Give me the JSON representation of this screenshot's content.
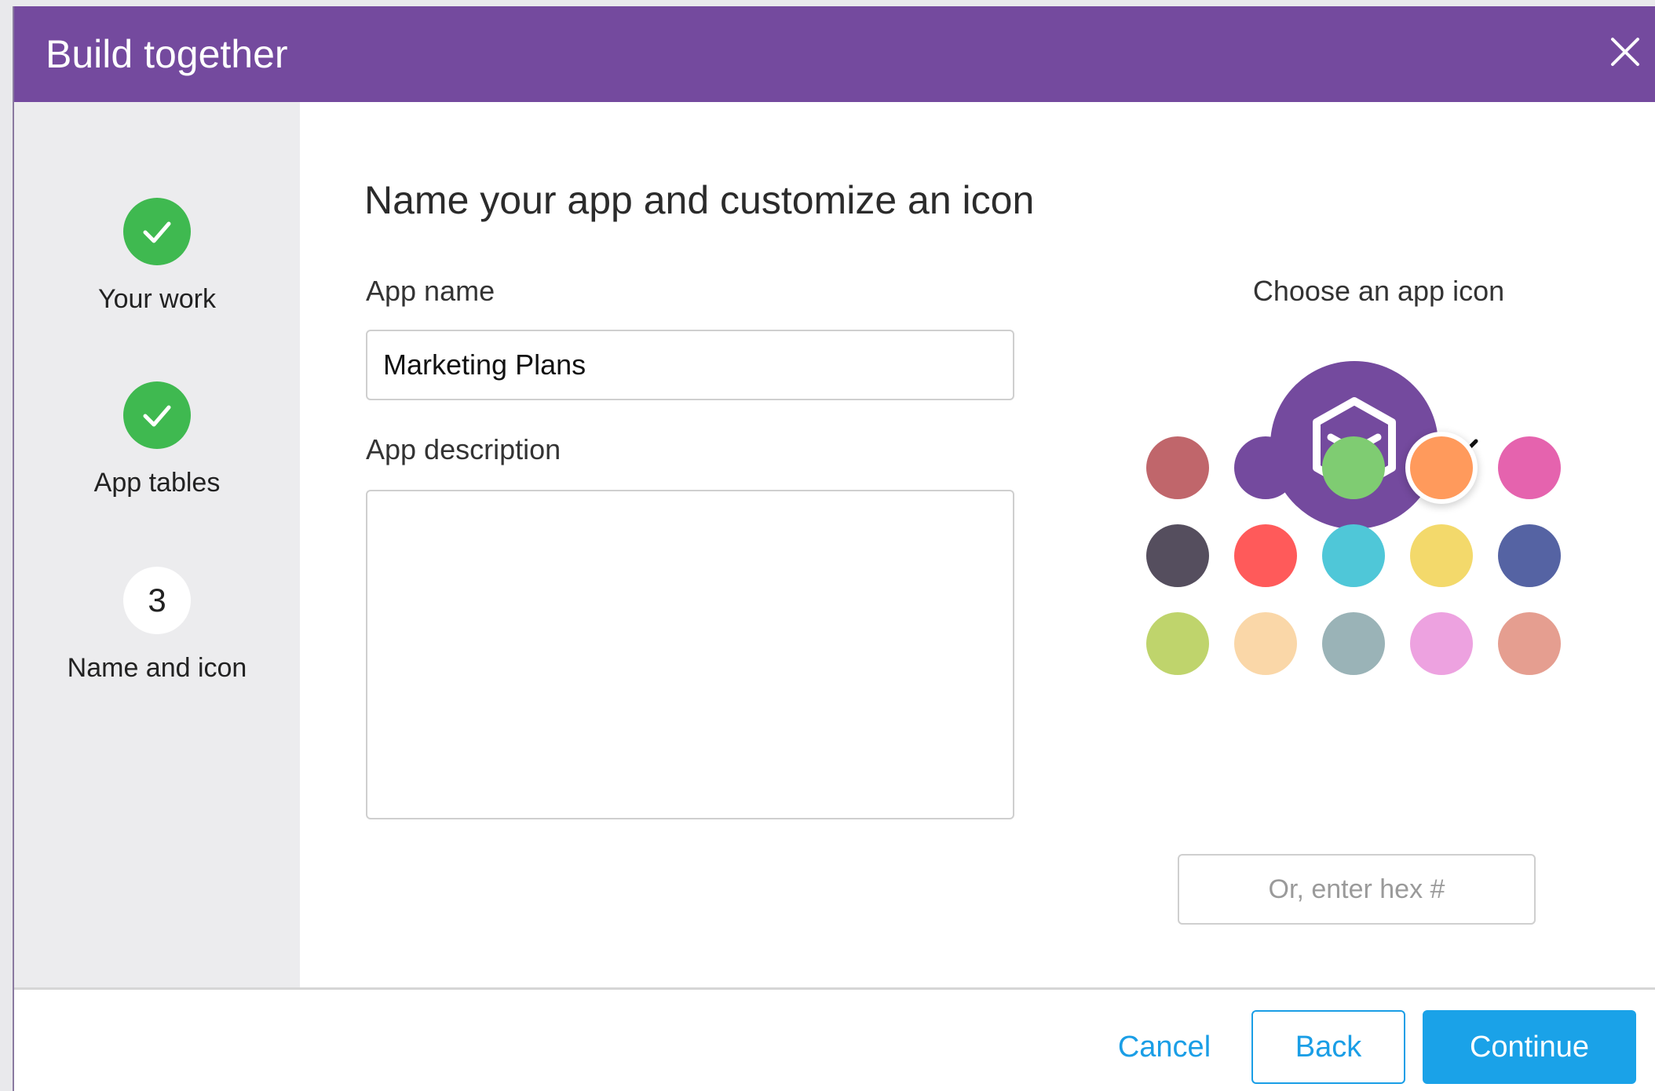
{
  "dialog": {
    "title": "Build together"
  },
  "steps": [
    {
      "label": "Your work",
      "status": "done"
    },
    {
      "label": "App tables",
      "status": "done"
    },
    {
      "label": "Name and icon",
      "status": "current",
      "number": "3"
    }
  ],
  "main": {
    "heading": "Name your app and customize an icon",
    "app_name_label": "App name",
    "app_name_value": "Marketing Plans",
    "app_description_label": "App description",
    "app_description_value": ""
  },
  "icon": {
    "label": "Choose an app icon",
    "icon_name": "app-cube-icon",
    "preview_color": "#744a9e",
    "selected_color": "#ff9a5c",
    "swatches": [
      "#c0666b",
      "#744a9e",
      "#7fcc72",
      "#ff9a5c",
      "#e563ae",
      "#554e5e",
      "#ff5a5a",
      "#4fc7d8",
      "#f3d96b",
      "#5563a3",
      "#bfd46c",
      "#fad7a8",
      "#9ab3b7",
      "#eda2e0",
      "#e59e90"
    ],
    "hex_placeholder": "Or, enter hex #"
  },
  "footer": {
    "cancel_label": "Cancel",
    "back_label": "Back",
    "continue_label": "Continue"
  },
  "colors": {
    "header_bg": "#744a9e",
    "step_done": "#3fb950",
    "accent": "#1aa2e8"
  }
}
